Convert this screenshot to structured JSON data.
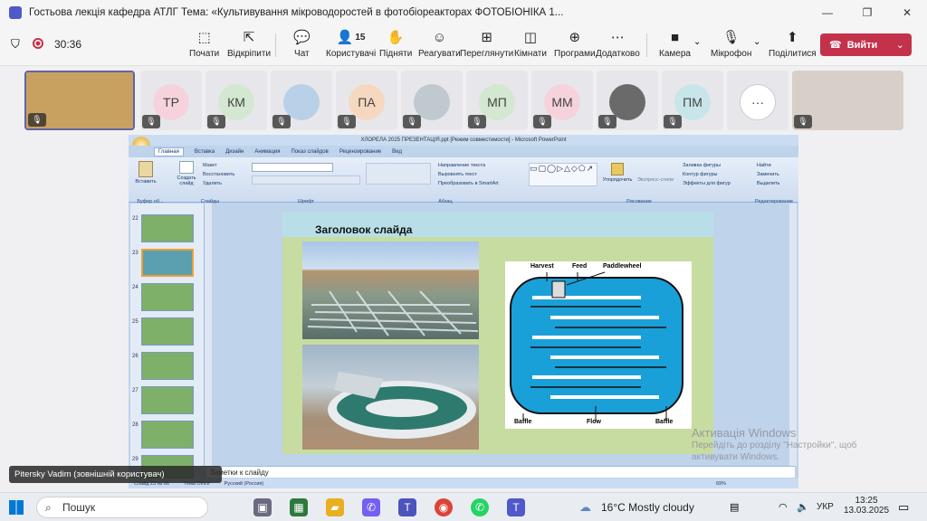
{
  "window": {
    "title": "Гостьова лекція кафедра АТЛГ Тема: «Культивування мікроводоростей в фотобіореакторах ФОТОБІОНІКА 1...",
    "minimize": "—",
    "restore": "❐",
    "close": "✕"
  },
  "meeting": {
    "timer": "30:36"
  },
  "toolbar": {
    "items": [
      {
        "label": "Почати",
        "icon": "⬚"
      },
      {
        "label": "Відкріпити",
        "icon": "⇱"
      },
      {
        "label": "Чат",
        "icon": "💬"
      },
      {
        "label": "Користувачі",
        "icon": "👤",
        "count": "15"
      },
      {
        "label": "Підняти",
        "icon": "✋"
      },
      {
        "label": "Реагувати",
        "icon": "☺"
      },
      {
        "label": "Переглянути",
        "icon": "⊞"
      },
      {
        "label": "Кімнати",
        "icon": "◫"
      },
      {
        "label": "Програми",
        "icon": "⊕"
      },
      {
        "label": "Додатково",
        "icon": "⋯"
      },
      {
        "label": "Камера",
        "icon": "■"
      },
      {
        "label": "Мікрофон",
        "icon": "🎙"
      },
      {
        "label": "Поділитися",
        "icon": "⬆"
      }
    ],
    "leave": "Вийти"
  },
  "participants": [
    {
      "initials": "",
      "bg": "#c8a060"
    },
    {
      "initials": "ТР",
      "bg": "#f6d3dc"
    },
    {
      "initials": "КМ",
      "bg": "#d4e7d0"
    },
    {
      "initials": "",
      "bg": "#b8d0e8"
    },
    {
      "initials": "ПА",
      "bg": "#f6d8c0"
    },
    {
      "initials": "",
      "bg": "#c0c8d0"
    },
    {
      "initials": "МП",
      "bg": "#d4e7d0"
    },
    {
      "initials": "ММ",
      "bg": "#f6d3dc"
    },
    {
      "initials": "",
      "bg": "#6a6a6a"
    },
    {
      "initials": "ПМ",
      "bg": "#c8e6ea"
    },
    {
      "initials": "···",
      "bg": "#ffffff"
    },
    {
      "initials": "",
      "bg": "#d8d0c8"
    }
  ],
  "powerpoint": {
    "title": "ХЛОРЕЛА 2025 ПРЕЗЕНТАЦІЯ.ppt [Режим совместимости] - Microsoft PowerPoint",
    "tabs": [
      "Главная",
      "Вставка",
      "Дизайн",
      "Анимация",
      "Показ слайдов",
      "Рецензирование",
      "Вид"
    ],
    "ribbon_groups": [
      "Буфер об...",
      "Слайды",
      "Шрифт",
      "Абзац",
      "Рисование",
      "Редактирование"
    ],
    "ribbon_buttons": [
      "Вставить",
      "Создать слайд",
      "Макет",
      "Восстановить",
      "Удалить",
      "Направление текста",
      "Выровнять текст",
      "Преобразовать в SmartArt",
      "Упорядочить",
      "Экспресс-стили",
      "Заливка фигуры",
      "Контур фигуры",
      "Эффекты для фигур",
      "Найти",
      "Заменить",
      "Выделить"
    ],
    "thumb_numbers": [
      "22",
      "23",
      "24",
      "25",
      "26",
      "27",
      "28",
      "29"
    ],
    "slide_title": "Заголовок слайда",
    "diagram_labels": {
      "harvest": "Harvest",
      "feed": "Feed",
      "paddlewheel": "Paddlewheel",
      "baffle_left": "Baffle",
      "flow": "Flow",
      "baffle_right": "Baffle"
    },
    "notes": "Заметки к слайду",
    "status": [
      "Слайд 23 из 66",
      "\"Тема Office\"",
      "Русский (Россия)"
    ],
    "zoom": "69%"
  },
  "nametag": "Pitersky Vadim (зовнішній користувач)",
  "watermark": {
    "line1": "Активація Windows",
    "line2": "Перейдіть до розділу \"Настройки\", щоб",
    "line3": "активувати Windows."
  },
  "taskbar": {
    "search": "Пошук",
    "weather": "16°C  Mostly cloudy",
    "lang": "УКР",
    "time": "13:25",
    "date": "13.03.2025"
  }
}
